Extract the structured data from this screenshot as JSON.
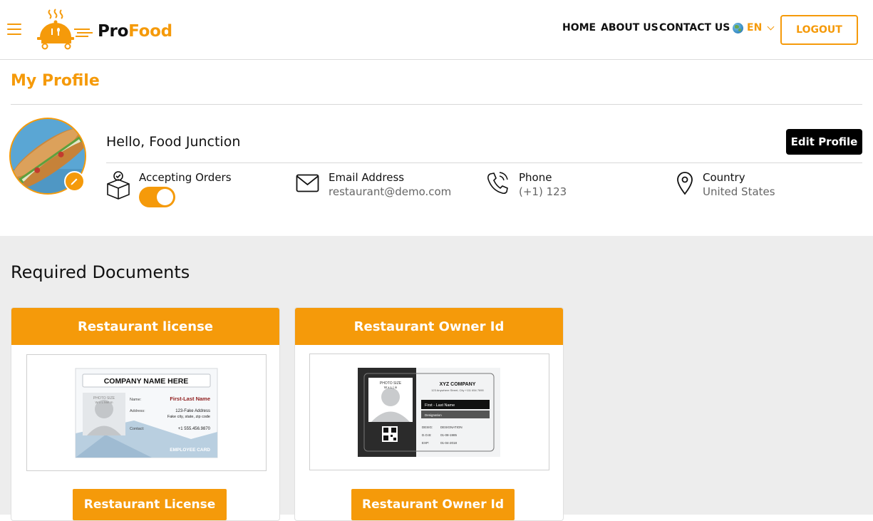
{
  "header": {
    "logo": {
      "part1": "Pro",
      "part2": "Food"
    },
    "nav": [
      "HOME",
      "ABOUT US",
      "CONTACT US"
    ],
    "language": "EN",
    "logout_label": "LOGOUT"
  },
  "profile": {
    "title": "My Profile",
    "greeting": "Hello, Food Junction",
    "edit_label": "Edit Profile",
    "accepting_orders": {
      "label": "Accepting Orders",
      "enabled": true
    },
    "email": {
      "label": "Email Address",
      "value": "restaurant@demo.com"
    },
    "phone": {
      "label": "Phone",
      "value": "(+1) 123"
    },
    "country": {
      "label": "Country",
      "value": "United States"
    }
  },
  "documents": {
    "title": "Required Documents",
    "cards": [
      {
        "header": "Restaurant license",
        "button": "Restaurant License",
        "id_card": {
          "company": "COMPANY NAME HERE",
          "photo_text": "PHOTO SIZE",
          "photo_sub": "W x L Met In",
          "name_label": "Name:",
          "name_value": "First-Last Name",
          "address_label": "Address:",
          "address_line1": "123-Fake Address",
          "address_line2": "Fake city, state, zip code",
          "contact_label": "Contact:",
          "contact_value": "+1 555.456.9870",
          "footer": "EMPLOYEE CARD"
        }
      },
      {
        "header": "Restaurant Owner Id",
        "button": "Restaurant Owner Id",
        "id_card": {
          "company": "XYZ COMPANY",
          "address": "123 Anywhere Street, City +111 654 7890",
          "photo_text": "PHOTO SIZE",
          "photo_sub": "W x L | in",
          "name_bar": "First - Last Name",
          "designation_bar": "Designation",
          "desig_label": "DESIG:",
          "desig_value": "DESIGNATION",
          "dob_label": "D.O.B:",
          "dob_value": "01-08-1985",
          "exp_label": "EXP:",
          "exp_value": "01-04-2018"
        }
      }
    ]
  },
  "colors": {
    "accent": "#f59a0a",
    "dark": "#000000",
    "section_bg": "#ededed"
  }
}
